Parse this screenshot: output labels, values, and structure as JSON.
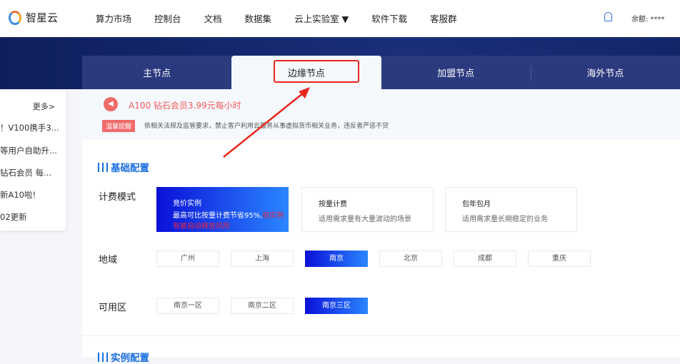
{
  "brand": "智星云",
  "nav": [
    "算力市场",
    "控制台",
    "文档",
    "数据集",
    "云上实验室 ▼",
    "软件下载",
    "客服群"
  ],
  "balance": "余额: ****",
  "tabs": [
    "主节点",
    "边缘节点",
    "加盟节点",
    "海外节点"
  ],
  "active_tab": 1,
  "sidebar": {
    "more": "更多>",
    "items": [
      "！V100携手3...",
      "等用户自助升...",
      "钻石会员 每...",
      "新A10啦!",
      "02更新"
    ]
  },
  "notice": {
    "promo": "A100 钻石会员3.99元每小时",
    "badge": "温馨提醒",
    "text": "依相关法规及监管要求，禁止客户利用云服务从事虚拟货币相关业务，违反者严惩不贷"
  },
  "basic": {
    "title": "基础配置",
    "billing_label": "计费模式",
    "billing": [
      {
        "title": "竞价实例",
        "desc": "最高可比按量计费节省95%,",
        "risk": "但实例有被自动释放风险"
      },
      {
        "title": "按量计费",
        "desc": "适用需求量有大量波动的场景"
      },
      {
        "title": "包年包月",
        "desc": "适用需求量长期稳定的业务"
      }
    ],
    "region_label": "地域",
    "regions": [
      "广州",
      "上海",
      "南京",
      "北京",
      "成都",
      "重庆"
    ],
    "region_selected": "南京",
    "zone_label": "可用区",
    "zones": [
      "南京一区",
      "南京二区",
      "南京三区"
    ],
    "zone_selected": "南京三区"
  },
  "instance_title": "实例配置",
  "colors": {
    "accent": "#1a6fe0",
    "highlight": "#e8261c",
    "banner": "#1a2e7a"
  }
}
